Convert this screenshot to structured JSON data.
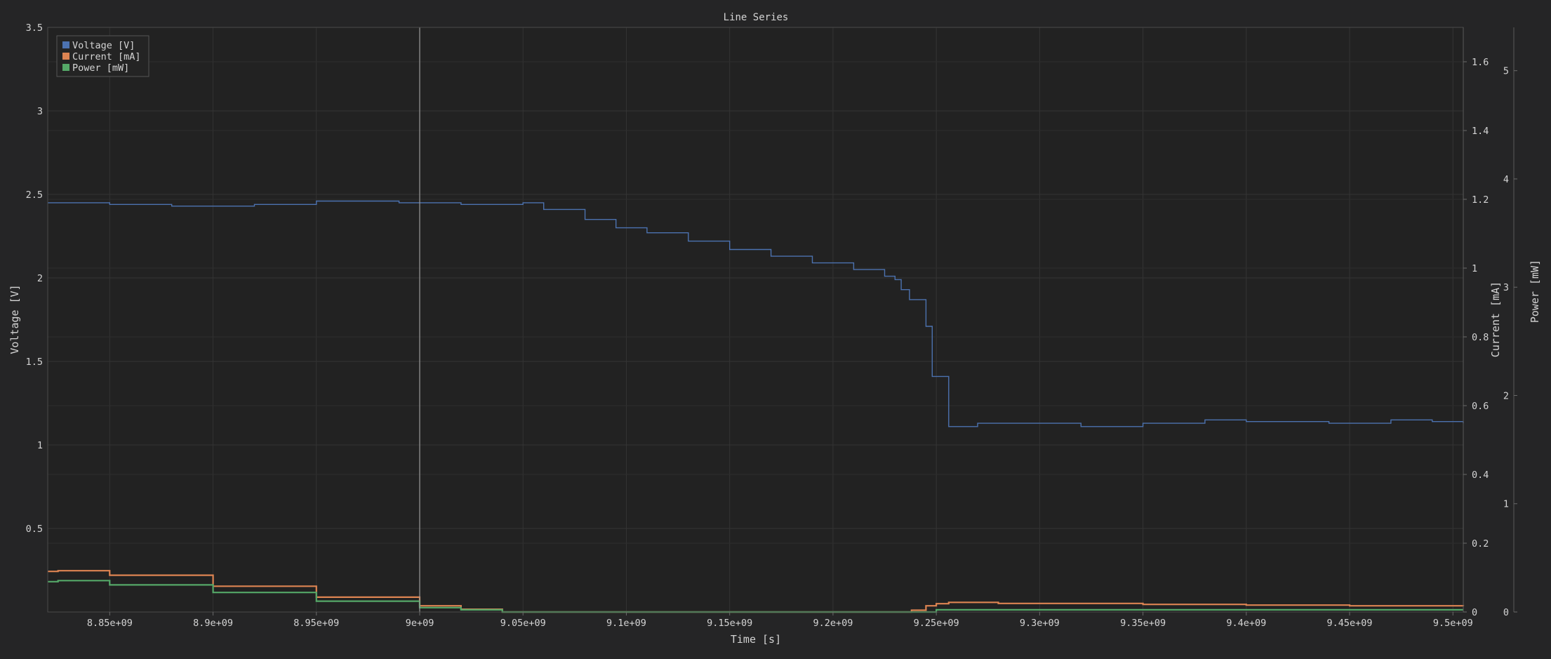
{
  "chart_data": {
    "type": "line",
    "title": "Line Series",
    "xlabel": "Time [s]",
    "ylabel_left": "Voltage [V]",
    "ylabel_right_1": "Current [mA]",
    "ylabel_right_2": "Power [mW]",
    "xlim": [
      8820000000,
      9505000000
    ],
    "ylim_left": [
      0,
      3.5
    ],
    "ylim_right_1": [
      0,
      1.7
    ],
    "ylim_right_2": [
      0,
      5.4
    ],
    "x_ticks": [
      {
        "value": 8850000000,
        "label": "8.85e+09"
      },
      {
        "value": 8900000000,
        "label": "8.9e+09"
      },
      {
        "value": 8950000000,
        "label": "8.95e+09"
      },
      {
        "value": 9000000000,
        "label": "9e+09"
      },
      {
        "value": 9050000000,
        "label": "9.05e+09"
      },
      {
        "value": 9100000000,
        "label": "9.1e+09"
      },
      {
        "value": 9150000000,
        "label": "9.15e+09"
      },
      {
        "value": 9200000000,
        "label": "9.2e+09"
      },
      {
        "value": 9250000000,
        "label": "9.25e+09"
      },
      {
        "value": 9300000000,
        "label": "9.3e+09"
      },
      {
        "value": 9350000000,
        "label": "9.35e+09"
      },
      {
        "value": 9400000000,
        "label": "9.4e+09"
      },
      {
        "value": 9450000000,
        "label": "9.45e+09"
      },
      {
        "value": 9500000000,
        "label": "9.5e+09"
      }
    ],
    "y_left_ticks": [
      {
        "value": 0.5,
        "label": "0.5"
      },
      {
        "value": 1,
        "label": "1"
      },
      {
        "value": 1.5,
        "label": "1.5"
      },
      {
        "value": 2,
        "label": "2"
      },
      {
        "value": 2.5,
        "label": "2.5"
      },
      {
        "value": 3,
        "label": "3"
      },
      {
        "value": 3.5,
        "label": "3.5"
      }
    ],
    "y_right_1_ticks": [
      {
        "value": 0,
        "label": "0"
      },
      {
        "value": 0.2,
        "label": "0.2"
      },
      {
        "value": 0.4,
        "label": "0.4"
      },
      {
        "value": 0.6,
        "label": "0.6"
      },
      {
        "value": 0.8,
        "label": "0.8"
      },
      {
        "value": 1,
        "label": "1"
      },
      {
        "value": 1.2,
        "label": "1.2"
      },
      {
        "value": 1.4,
        "label": "1.4"
      },
      {
        "value": 1.6,
        "label": "1.6"
      }
    ],
    "y_right_2_ticks": [
      {
        "value": 0,
        "label": "0"
      },
      {
        "value": 1,
        "label": "1"
      },
      {
        "value": 2,
        "label": "2"
      },
      {
        "value": 3,
        "label": "3"
      },
      {
        "value": 4,
        "label": "4"
      },
      {
        "value": 5,
        "label": "5"
      }
    ],
    "cursor_x": 9000000000,
    "grid": true,
    "legend_position": "top-left",
    "series": [
      {
        "name": "Voltage [V]",
        "axis": "left",
        "color": "#4c72b0",
        "x": [
          8820000000,
          8850000000,
          8880000000,
          8920000000,
          8950000000,
          8990000000,
          9020000000,
          9050000000,
          9060000000,
          9080000000,
          9095000000,
          9110000000,
          9130000000,
          9150000000,
          9170000000,
          9190000000,
          9210000000,
          9225000000,
          9230000000,
          9233000000,
          9237000000,
          9240000000,
          9245000000,
          9248000000,
          9252000000,
          9256000000,
          9270000000,
          9300000000,
          9320000000,
          9350000000,
          9380000000,
          9400000000,
          9440000000,
          9470000000,
          9490000000,
          9505000000
        ],
        "y": [
          2.45,
          2.44,
          2.43,
          2.44,
          2.46,
          2.45,
          2.44,
          2.45,
          2.41,
          2.35,
          2.3,
          2.27,
          2.22,
          2.17,
          2.13,
          2.09,
          2.05,
          2.01,
          1.99,
          1.93,
          1.87,
          1.87,
          1.71,
          1.41,
          1.41,
          1.11,
          1.13,
          1.13,
          1.11,
          1.13,
          1.15,
          1.14,
          1.13,
          1.15,
          1.14,
          1.13
        ]
      },
      {
        "name": "Current [mA]",
        "axis": "right_1",
        "color": "#dd8452",
        "x": [
          8820000000,
          8825000000,
          8850000000,
          8900000000,
          8950000000,
          9000000000,
          9020000000,
          9040000000,
          9220000000,
          9238000000,
          9245000000,
          9250000000,
          9256000000,
          9280000000,
          9350000000,
          9400000000,
          9450000000,
          9505000000
        ],
        "y": [
          0.118,
          0.12,
          0.107,
          0.075,
          0.043,
          0.018,
          0.008,
          0.0,
          0.0,
          0.005,
          0.018,
          0.024,
          0.028,
          0.025,
          0.022,
          0.02,
          0.018,
          0.017
        ]
      },
      {
        "name": "Power [mW]",
        "axis": "right_2",
        "color": "#55a868",
        "x": [
          8820000000,
          8825000000,
          8850000000,
          8900000000,
          8950000000,
          9000000000,
          9020000000,
          9040000000,
          9240000000,
          9250000000,
          9300000000,
          9400000000,
          9505000000
        ],
        "y": [
          0.28,
          0.29,
          0.25,
          0.18,
          0.1,
          0.04,
          0.02,
          0.0,
          0.0,
          0.02,
          0.02,
          0.02,
          0.02
        ]
      }
    ]
  }
}
